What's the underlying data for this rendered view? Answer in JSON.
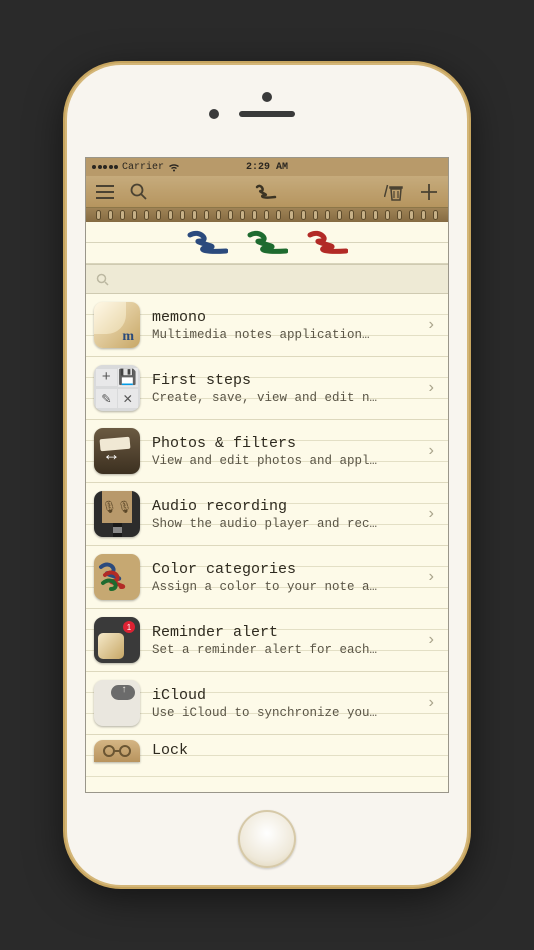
{
  "status": {
    "carrier": "Carrier",
    "time": "2:29 AM"
  },
  "scribbles": [
    {
      "color": "#2b4a7d"
    },
    {
      "color": "#1e6b2f"
    },
    {
      "color": "#b22a26"
    }
  ],
  "search": {
    "placeholder": ""
  },
  "notes": [
    {
      "title": "memono",
      "subtitle": "Multimedia notes application…",
      "thumb": "memono"
    },
    {
      "title": "First steps",
      "subtitle": "Create, save, view and edit n…",
      "thumb": "grid"
    },
    {
      "title": "Photos & filters",
      "subtitle": "View and edit photos and appl…",
      "thumb": "photos"
    },
    {
      "title": "Audio recording",
      "subtitle": "Show the audio player and rec…",
      "thumb": "audio"
    },
    {
      "title": "Color categories",
      "subtitle": "Assign a color to your note a…",
      "thumb": "colors"
    },
    {
      "title": "Reminder alert",
      "subtitle": "Set a reminder alert for each…",
      "thumb": "reminder"
    },
    {
      "title": "iCloud",
      "subtitle": "Use iCloud to synchronize you…",
      "thumb": "icloud"
    },
    {
      "title": "Lock",
      "subtitle": "",
      "thumb": "lock",
      "partial": true
    }
  ]
}
